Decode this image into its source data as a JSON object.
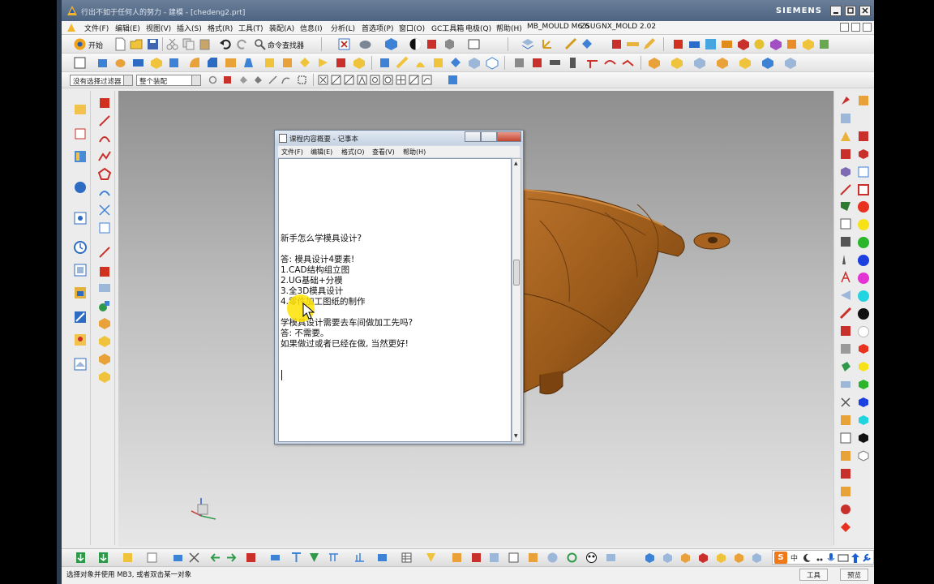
{
  "titlebar": {
    "title": "行出不如于任何人的努力 - 建模 - [chedeng2.prt]",
    "brand": "SIEMENS"
  },
  "menubar": {
    "items": [
      "文件(F)",
      "编辑(E)",
      "视图(V)",
      "插入(S)",
      "格式(R)",
      "工具(T)",
      "装配(A)",
      "信息(I)",
      "分析(L)",
      "首选项(P)",
      "窗口(O)",
      "GC工具箱",
      "电极(Q)",
      "帮助(H)",
      "MB_MOULD M6.6",
      "ZSUG",
      "NX_MOLD 2.02"
    ]
  },
  "toolbar1": {
    "start_label": "开始",
    "command_finder_label": "命令查找器"
  },
  "selection": {
    "filter_value": "没有选择过滤器",
    "scope_value": "整个装配"
  },
  "notepad": {
    "title": "课程内容概要 - 记事本",
    "menus": [
      "文件(F)",
      "编辑(E)",
      "格式(O)",
      "查看(V)",
      "帮助(H)"
    ],
    "lines": [
      "新手怎么学模具设计?",
      "",
      "答: 模具设计4要素!",
      "    1.CAD结构组立图",
      "    2.UG基础+分模",
      "    3.全3D模具设计",
      "    4.零件加工图纸的制作",
      "",
      "学模具设计需要去车间做加工先吗?",
      "答: 不需要。",
      "     如果做过或者已经在做, 当然更好!"
    ]
  },
  "statusbar": {
    "prompt": "选择对象并使用 MB3, 或者双击某一对象",
    "tools_label": "工具",
    "preview_label": "预览"
  },
  "ime": {
    "logo": "S",
    "mode": "中"
  },
  "colors": {
    "titlebar": "#4d6482",
    "model": "#9a5a1a",
    "highlight": "#ffe200",
    "notepad_frame": "#cfd9e6"
  }
}
